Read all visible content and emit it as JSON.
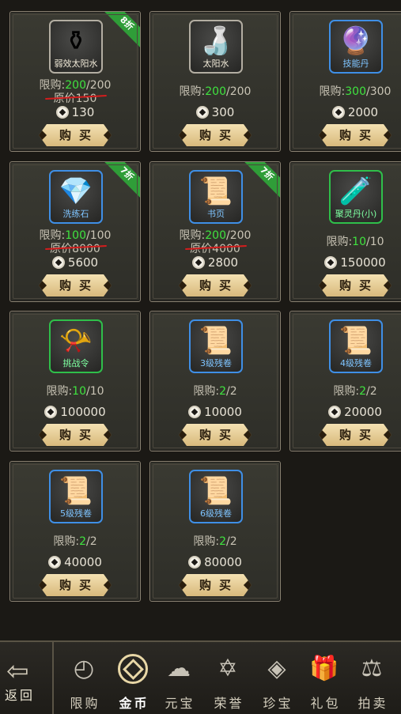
{
  "shop": {
    "buy_label": "购买",
    "items": [
      {
        "name": "弱效太阳水",
        "glyph": "⚱",
        "frame": "white",
        "ribbon": "8折",
        "limit_prefix": "限购:",
        "limit_current": "200",
        "limit_total": "/200",
        "original_price": "原价150",
        "price": "130"
      },
      {
        "name": "太阳水",
        "glyph": "🍶",
        "frame": "white",
        "ribbon": "",
        "limit_prefix": "限购:",
        "limit_current": "200",
        "limit_total": "/200",
        "original_price": "",
        "price": "300"
      },
      {
        "name": "技能丹",
        "glyph": "🔮",
        "frame": "blue",
        "ribbon": "",
        "limit_prefix": "限购:",
        "limit_current": "300",
        "limit_total": "/300",
        "original_price": "",
        "price": "2000"
      },
      {
        "name": "洗练石",
        "glyph": "💎",
        "frame": "blue",
        "ribbon": "7折",
        "limit_prefix": "限购:",
        "limit_current": "100",
        "limit_total": "/100",
        "original_price": "原价8000",
        "price": "5600"
      },
      {
        "name": "书页",
        "glyph": "📜",
        "frame": "blue",
        "ribbon": "7折",
        "limit_prefix": "限购:",
        "limit_current": "200",
        "limit_total": "/200",
        "original_price": "原价4000",
        "price": "2800"
      },
      {
        "name": "聚灵丹(小)",
        "glyph": "🧪",
        "frame": "green",
        "ribbon": "",
        "limit_prefix": "限购:",
        "limit_current": "10",
        "limit_total": "/10",
        "original_price": "",
        "price": "150000"
      },
      {
        "name": "挑战令",
        "glyph": "📯",
        "frame": "green",
        "ribbon": "",
        "limit_prefix": "限购:",
        "limit_current": "10",
        "limit_total": "/10",
        "original_price": "",
        "price": "100000"
      },
      {
        "name": "3级残卷",
        "glyph": "📜",
        "frame": "blue",
        "ribbon": "",
        "limit_prefix": "限购:",
        "limit_current": "2",
        "limit_total": "/2",
        "original_price": "",
        "price": "10000"
      },
      {
        "name": "4级残卷",
        "glyph": "📜",
        "frame": "blue",
        "ribbon": "",
        "limit_prefix": "限购:",
        "limit_current": "2",
        "limit_total": "/2",
        "original_price": "",
        "price": "20000"
      },
      {
        "name": "5级残卷",
        "glyph": "📜",
        "frame": "blue",
        "ribbon": "",
        "limit_prefix": "限购:",
        "limit_current": "2",
        "limit_total": "/2",
        "original_price": "",
        "price": "40000"
      },
      {
        "name": "6级残卷",
        "glyph": "📜",
        "frame": "blue",
        "ribbon": "",
        "limit_prefix": "限购:",
        "limit_current": "2",
        "limit_total": "/2",
        "original_price": "",
        "price": "80000"
      }
    ]
  },
  "nav": {
    "back_label": "返回",
    "back_icon": "back-arrow-icon",
    "tabs": [
      {
        "label": "限购",
        "icon": "clock-icon",
        "glyph": "◴",
        "active": false
      },
      {
        "label": "金币",
        "icon": "gold-coin-icon",
        "glyph": "",
        "active": true
      },
      {
        "label": "元宝",
        "icon": "ingot-icon",
        "glyph": "☁",
        "active": false
      },
      {
        "label": "荣誉",
        "icon": "star-badge-icon",
        "glyph": "✡",
        "active": false
      },
      {
        "label": "珍宝",
        "icon": "gem-icon",
        "glyph": "◈",
        "active": false
      },
      {
        "label": "礼包",
        "icon": "gift-icon",
        "glyph": "🎁",
        "active": false
      },
      {
        "label": "拍卖",
        "icon": "gavel-icon",
        "glyph": "⚖",
        "active": false
      }
    ]
  },
  "colors": {
    "limit_current": "#3fe33f",
    "strike": "#d41d1d",
    "ribbon": "#2f9d38",
    "frame_blue": "#3f8fe6",
    "frame_green": "#2fbf4a",
    "frame_white": "#b3aea2"
  }
}
